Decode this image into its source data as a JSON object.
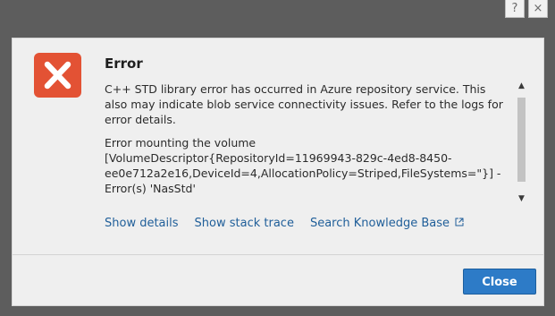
{
  "window": {
    "help_glyph": "?",
    "close_glyph": "×"
  },
  "dialog": {
    "title": "Error",
    "message_1": "C++ STD library error has occurred in Azure repository service. This also may indicate blob service connectivity issues. Refer to the logs for error details.",
    "message_2": "Error mounting the volume [VolumeDescriptor{RepositoryId=11969943-829c-4ed8-8450-ee0e712a2e16,DeviceId=4,AllocationPolicy=Striped,FileSystems=\"}] - Error(s) 'NasStd'",
    "links": {
      "show_details": "Show details",
      "show_stack_trace": "Show stack trace",
      "search_kb": "Search Knowledge Base"
    },
    "close_label": "Close"
  },
  "icons": {
    "error": "error-x-icon",
    "external": "external-link-icon"
  },
  "colors": {
    "error_icon_bg": "#e35234",
    "link": "#1f5e99",
    "primary_button": "#2d7bc7"
  }
}
